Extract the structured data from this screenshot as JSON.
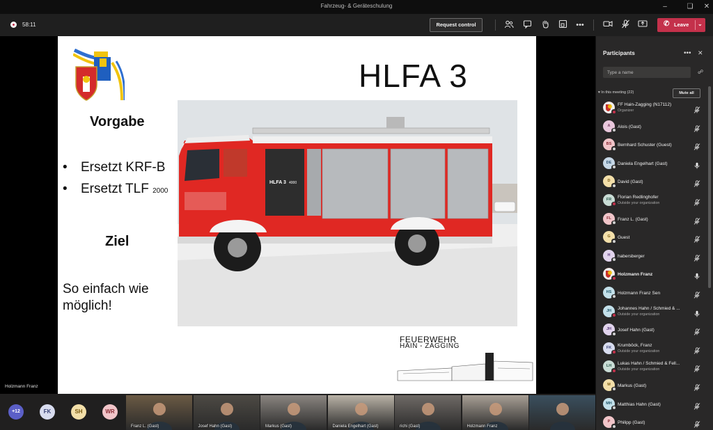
{
  "window": {
    "title": "Fahrzeug- & Geräteschulung",
    "controls": [
      "minimize",
      "restore",
      "close"
    ]
  },
  "meeting_bar": {
    "timer": "58:11",
    "request_control": "Request control",
    "leave_label": "Leave",
    "icons": [
      "participants-icon",
      "chat-icon",
      "raise-hand-icon",
      "breakout-icon",
      "more-icon",
      "camera-off-icon",
      "mic-off-icon",
      "share-screen-icon"
    ]
  },
  "stage": {
    "presenter_name": "Holzmann Franz",
    "slide": {
      "title": "HLFA 3",
      "section1": "Vorgabe",
      "bullets": [
        {
          "text": "Ersetzt KRF-B",
          "sub": ""
        },
        {
          "text": "Ersetzt TLF",
          "sub": "2000"
        }
      ],
      "section2": "Ziel",
      "goal": "So einfach wie möglich!",
      "truck_label": "HLFA 3",
      "truck_number": "4000",
      "logo_line1": "FEUERWEHR",
      "logo_line2": "HAIN - ZAGGING",
      "logo_sign": "FEUERWEHR"
    }
  },
  "participants_panel": {
    "title": "Participants",
    "search_placeholder": "Type a name",
    "section_label": "In this meeting (22)",
    "mute_all": "Mute all",
    "participants": [
      {
        "initials": "",
        "name": "FF Hain-Zagging (N17112)",
        "sub": "Organizer",
        "avatar_bg": "#b33a2e",
        "avatar_fg": "#fff",
        "mic": "muted",
        "status": "red",
        "photo": true,
        "bold": false
      },
      {
        "initials": "A",
        "name": "Alois (Gast)",
        "sub": "",
        "avatar_bg": "#e9c7dc",
        "avatar_fg": "#7a3d64",
        "mic": "muted",
        "status": "away",
        "photo": false,
        "bold": false
      },
      {
        "initials": "BS",
        "name": "Bernhard Schuster (Guest)",
        "sub": "",
        "avatar_bg": "#f1c5c9",
        "avatar_fg": "#8a2c35",
        "mic": "muted",
        "status": "away",
        "photo": false,
        "bold": false
      },
      {
        "initials": "DE",
        "name": "Daniela Engelhart (Gast)",
        "sub": "",
        "avatar_bg": "#c6d7e6",
        "avatar_fg": "#2b4f6e",
        "mic": "on",
        "status": "away",
        "photo": false,
        "bold": false
      },
      {
        "initials": "D",
        "name": "David (Gast)",
        "sub": "",
        "avatar_bg": "#f3dfa9",
        "avatar_fg": "#7a5b12",
        "mic": "muted",
        "status": "away",
        "photo": false,
        "bold": false
      },
      {
        "initials": "FR",
        "name": "Florian Redlinghofer",
        "sub": "Outside your organization",
        "avatar_bg": "#c9dcd5",
        "avatar_fg": "#2c5a4c",
        "mic": "muted",
        "status": "red",
        "photo": false,
        "bold": false
      },
      {
        "initials": "FL",
        "name": "Franz L. (Gast)",
        "sub": "",
        "avatar_bg": "#f1c5c9",
        "avatar_fg": "#8a2c35",
        "mic": "muted",
        "status": "away",
        "photo": false,
        "bold": false
      },
      {
        "initials": "G",
        "name": "Guest",
        "sub": "",
        "avatar_bg": "#f3dfa9",
        "avatar_fg": "#7a5b12",
        "mic": "muted",
        "status": "away",
        "photo": false,
        "bold": false
      },
      {
        "initials": "H",
        "name": "habersberger",
        "sub": "",
        "avatar_bg": "#e1d3ec",
        "avatar_fg": "#5a3a7a",
        "mic": "muted",
        "status": "away",
        "photo": false,
        "bold": false
      },
      {
        "initials": "",
        "name": "Holzmann Franz",
        "sub": "",
        "avatar_bg": "#b33a2e",
        "avatar_fg": "#fff",
        "mic": "on",
        "status": "red",
        "photo": true,
        "bold": true
      },
      {
        "initials": "HS",
        "name": "Holzmann Franz Sen",
        "sub": "",
        "avatar_bg": "#c3e0ea",
        "avatar_fg": "#22586b",
        "mic": "muted",
        "status": "away",
        "photo": false,
        "bold": false
      },
      {
        "initials": "JH",
        "name": "Johannes Hahn / Schmied & ...",
        "sub": "Outside your organization",
        "avatar_bg": "#c3e0ea",
        "avatar_fg": "#22586b",
        "mic": "on",
        "status": "red",
        "photo": false,
        "bold": false
      },
      {
        "initials": "JH",
        "name": "Josef Hahn (Gast)",
        "sub": "",
        "avatar_bg": "#e1d3ec",
        "avatar_fg": "#5a3a7a",
        "mic": "muted",
        "status": "away",
        "photo": false,
        "bold": false
      },
      {
        "initials": "FK",
        "name": "Krumböck, Franz",
        "sub": "Outside your organization",
        "avatar_bg": "#d8dcef",
        "avatar_fg": "#3b4478",
        "mic": "muted",
        "status": "red",
        "photo": false,
        "bold": false
      },
      {
        "initials": "LH",
        "name": "Lukas Hahn / Schmied & Fell...",
        "sub": "Outside your organization",
        "avatar_bg": "#c9dcd5",
        "avatar_fg": "#2c5a4c",
        "mic": "muted",
        "status": "red",
        "photo": false,
        "bold": false
      },
      {
        "initials": "M",
        "name": "Markus (Gast)",
        "sub": "",
        "avatar_bg": "#f3dfa9",
        "avatar_fg": "#7a5b12",
        "mic": "muted",
        "status": "away",
        "photo": false,
        "bold": false
      },
      {
        "initials": "MH",
        "name": "Matthias Hahn (Gast)",
        "sub": "",
        "avatar_bg": "#c3e0ea",
        "avatar_fg": "#22586b",
        "mic": "muted",
        "status": "away",
        "photo": false,
        "bold": false
      },
      {
        "initials": "P",
        "name": "Philipp (Gast)",
        "sub": "",
        "avatar_bg": "#f1c5c9",
        "avatar_fg": "#8a2c35",
        "mic": "muted",
        "status": "away",
        "photo": false,
        "bold": false
      }
    ]
  },
  "gallery": {
    "overflow_count": "+12",
    "avatars": [
      {
        "initials": "FK",
        "bg": "#d8dcef",
        "fg": "#3b4478"
      },
      {
        "initials": "SH",
        "bg": "#f3dfa9",
        "fg": "#7a5b12"
      },
      {
        "initials": "WR",
        "bg": "#f1c5c9",
        "fg": "#8a2c35"
      }
    ],
    "videos": [
      {
        "name": "Franz L. (Gast)",
        "bg": "#6b5a44"
      },
      {
        "name": "Josef Hahn (Gast)",
        "bg": "#4d4a44"
      },
      {
        "name": "Markus (Gast)",
        "bg": "#8a8580"
      },
      {
        "name": "Daniela Engelhart (Gast)",
        "bg": "#b9b2a6"
      },
      {
        "name": "richi (Gast)",
        "bg": "#6f6a66"
      },
      {
        "name": "Holzmann Franz",
        "bg": "#a89f95"
      },
      {
        "name": "",
        "bg": "#3a4f5e"
      }
    ]
  }
}
